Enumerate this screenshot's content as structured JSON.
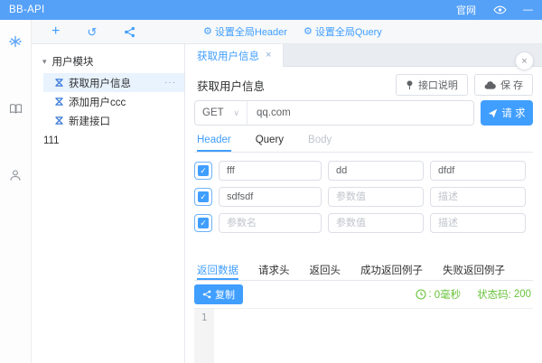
{
  "colors": {
    "accent": "#409eff",
    "titlebar": "#55a1f8",
    "success": "#67c23a",
    "selected_row": "#e8f3fe"
  },
  "icons": {
    "gear": "⚙",
    "plus": "+",
    "refresh": "↺",
    "caret_down": "▾",
    "more": "···",
    "close": "×",
    "chevron_down": "∨",
    "minus": "—",
    "check": "✓",
    "colon": ":"
  },
  "titlebar": {
    "app_name": "BB-API",
    "website_link": "官网"
  },
  "toolbar": {
    "set_global_header": "设置全局Header",
    "set_global_query": "设置全局Query"
  },
  "tree": {
    "module_label": "用户模块",
    "items": [
      {
        "label": "获取用户信息"
      },
      {
        "label": "添加用户ccc"
      },
      {
        "label": "新建接口"
      }
    ],
    "root_item": "111"
  },
  "main": {
    "tab_label": "获取用户信息",
    "api_title": "获取用户信息",
    "doc_button": "接口说明",
    "save_button": "保 存",
    "request": {
      "method": "GET",
      "url": "qq.com",
      "send_button": "请 求"
    },
    "param_tabs": [
      "Header",
      "Query",
      "Body"
    ],
    "params": [
      {
        "name": "fff",
        "value": "dd",
        "desc": "dfdf"
      },
      {
        "name": "sdfsdf",
        "value_placeholder": "参数值",
        "desc_placeholder": "描述"
      },
      {
        "name_placeholder": "参数名",
        "value_placeholder": "参数值",
        "desc_placeholder": "描述"
      }
    ],
    "result_tabs": [
      "返回数据",
      "请求头",
      "返回头",
      "成功返回例子",
      "失败返回例子"
    ],
    "copy_button": "复制",
    "elapsed": "0毫秒",
    "status_label": "状态码:",
    "status_value": "200",
    "editor_line_number": "1"
  }
}
